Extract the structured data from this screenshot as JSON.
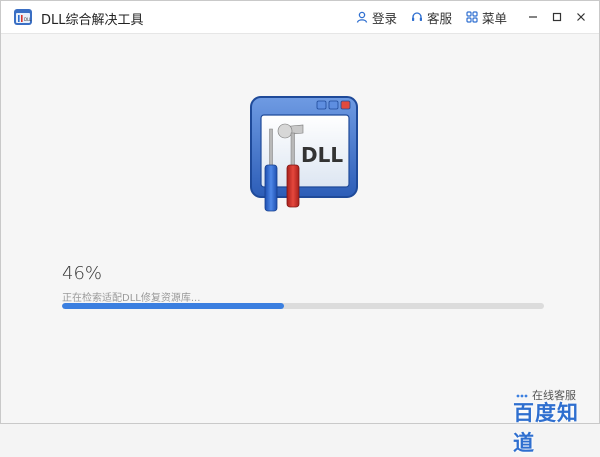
{
  "window": {
    "title": "DLL综合解决工具",
    "actions": {
      "login": "登录",
      "support": "客服",
      "menu": "菜单"
    },
    "controls": [
      "minimize",
      "maximize",
      "close"
    ]
  },
  "hero": {
    "icon": "dll-tools-icon",
    "label": "DLL"
  },
  "progress": {
    "percent_text": "46%",
    "fraction": 0.46,
    "status": "正在检索适配DLL修复资源库...",
    "color": "#3b7fe0",
    "track_color": "#dcdcdc"
  },
  "footer": {
    "online_service": "在线客服",
    "watermark": "百度知道"
  }
}
